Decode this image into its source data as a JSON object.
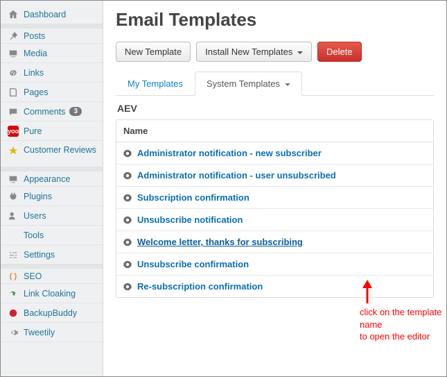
{
  "sidebar": {
    "items": [
      {
        "label": "Dashboard"
      },
      {
        "label": "Posts"
      },
      {
        "label": "Media"
      },
      {
        "label": "Links"
      },
      {
        "label": "Pages"
      },
      {
        "label": "Comments",
        "badge": "3"
      },
      {
        "label": "Pure"
      },
      {
        "label": "Customer Reviews"
      },
      {
        "label": "Appearance"
      },
      {
        "label": "Plugins"
      },
      {
        "label": "Users"
      },
      {
        "label": "Tools"
      },
      {
        "label": "Settings"
      },
      {
        "label": "SEO"
      },
      {
        "label": "Link Cloaking"
      },
      {
        "label": "BackupBuddy"
      },
      {
        "label": "Tweetily"
      }
    ]
  },
  "page": {
    "title": "Email Templates",
    "buttons": {
      "new": "New Template",
      "install": "Install New Templates",
      "delete": "Delete"
    },
    "tabs": {
      "my": "My Templates",
      "system": "System Templates"
    },
    "section": "AEV",
    "col_name": "Name",
    "templates": [
      {
        "name": "Administrator notification - new subscriber"
      },
      {
        "name": "Administrator notification - user unsubscribed"
      },
      {
        "name": "Subscription confirmation"
      },
      {
        "name": "Unsubscribe notification"
      },
      {
        "name": "Welcome letter, thanks for subscribing",
        "hover": true
      },
      {
        "name": "Unsubscribe confirmation"
      },
      {
        "name": "Re-subscription confirmation"
      }
    ]
  },
  "annotation": {
    "line1": "click on the template name",
    "line2": "to open the editor"
  }
}
